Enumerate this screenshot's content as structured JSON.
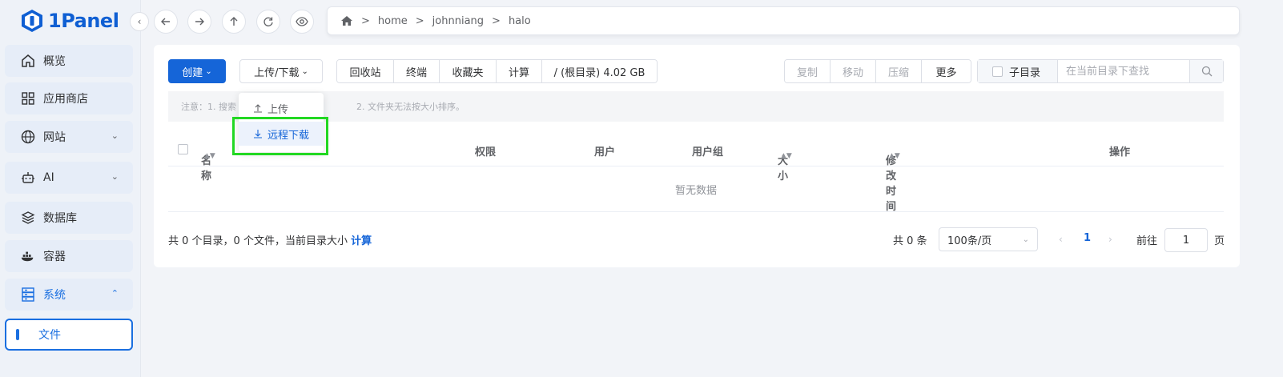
{
  "app": {
    "logo_text": "1Panel"
  },
  "sidebar": {
    "items": [
      {
        "label": "概览",
        "icon": "home-icon"
      },
      {
        "label": "应用商店",
        "icon": "apps-icon"
      },
      {
        "label": "网站",
        "icon": "globe-icon",
        "expandable": true
      },
      {
        "label": "AI",
        "icon": "robot-icon",
        "expandable": true
      },
      {
        "label": "数据库",
        "icon": "database-icon"
      },
      {
        "label": "容器",
        "icon": "docker-icon"
      },
      {
        "label": "系统",
        "icon": "server-icon",
        "expanded": true
      },
      {
        "label": "文件",
        "active": true
      }
    ]
  },
  "path": {
    "segments": [
      "home",
      "johnniang",
      "halo"
    ],
    "separator": ">"
  },
  "toolbar": {
    "create_label": "创建",
    "upload_label": "上传/下载",
    "group_buttons": [
      "回收站",
      "终端",
      "收藏夹",
      "计算",
      "/ (根目录) 4.02 GB"
    ],
    "action_buttons": [
      "复制",
      "移动",
      "压缩",
      "更多"
    ],
    "subdir_label": "子目录",
    "search_placeholder": "在当前目录下查找"
  },
  "dropdown": {
    "items": [
      "上传",
      "远程下载"
    ],
    "highlighted": "远程下载"
  },
  "notice": {
    "text": "注意：1. 搜索",
    "text2": "2. 文件夹无法按大小排序。"
  },
  "table": {
    "columns": [
      "名称",
      "权限",
      "用户",
      "用户组",
      "大小",
      "修改时间",
      "操作"
    ],
    "empty_text": "暂无数据"
  },
  "footer": {
    "summary": "共 0 个目录，0 个文件，当前目录大小",
    "compute_link": "计算",
    "total": "共 0 条",
    "page_size": "100条/页",
    "current_page": "1",
    "goto_label": "前往",
    "goto_value": "1",
    "page_suffix": "页"
  },
  "colors": {
    "primary": "#1565d8",
    "highlight": "#22d822"
  }
}
